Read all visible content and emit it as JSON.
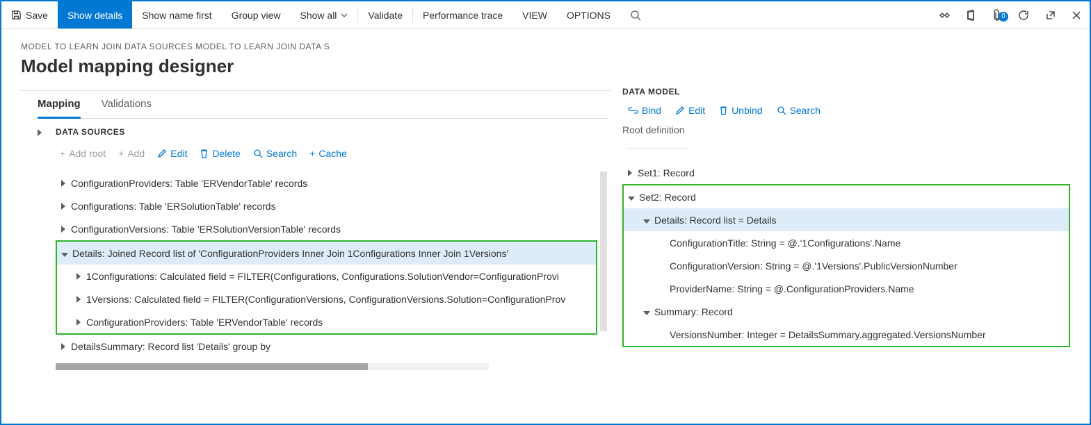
{
  "toolbar": {
    "save": "Save",
    "show_details": "Show details",
    "show_name_first": "Show name first",
    "group_view": "Group view",
    "show_all": "Show all",
    "validate": "Validate",
    "perf_trace": "Performance trace",
    "view": "VIEW",
    "options": "OPTIONS",
    "badge": "0"
  },
  "breadcrumb": "MODEL TO LEARN JOIN DATA SOURCES MODEL TO LEARN JOIN DATA S",
  "page_title": "Model mapping designer",
  "tabs": {
    "mapping": "Mapping",
    "validations": "Validations"
  },
  "ds": {
    "head": "DATA SOURCES",
    "add_root": "Add root",
    "add": "Add",
    "edit": "Edit",
    "delete": "Delete",
    "search": "Search",
    "cache": "Cache",
    "rows": [
      "ConfigurationProviders: Table 'ERVendorTable' records",
      "Configurations: Table 'ERSolutionTable' records",
      "ConfigurationVersions: Table 'ERSolutionVersionTable' records",
      "Details: Joined Record list of 'ConfigurationProviders Inner Join 1Configurations Inner Join 1Versions'",
      "1Configurations: Calculated field = FILTER(Configurations, Configurations.SolutionVendor=ConfigurationProvi",
      "1Versions: Calculated field = FILTER(ConfigurationVersions, ConfigurationVersions.Solution=ConfigurationProv",
      "ConfigurationProviders: Table 'ERVendorTable' records",
      "DetailsSummary: Record list 'Details' group by"
    ]
  },
  "dm": {
    "head": "DATA MODEL",
    "bind": "Bind",
    "edit": "Edit",
    "unbind": "Unbind",
    "search": "Search",
    "root_def": "Root definition",
    "rows": [
      "Set1: Record",
      "Set2: Record",
      "Details: Record list = Details",
      "ConfigurationTitle: String = @.'1Configurations'.Name",
      "ConfigurationVersion: String = @.'1Versions'.PublicVersionNumber",
      "ProviderName: String = @.ConfigurationProviders.Name",
      "Summary: Record",
      "VersionsNumber: Integer = DetailsSummary.aggregated.VersionsNumber"
    ]
  }
}
